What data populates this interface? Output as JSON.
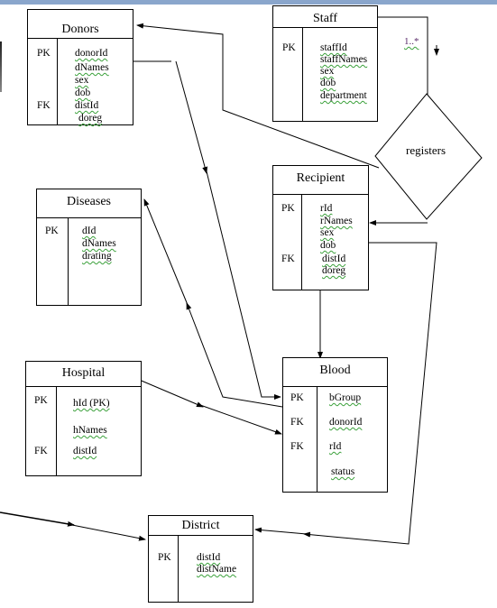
{
  "entities": [
    {
      "name": "Donors",
      "keys": [
        "PK",
        "FK"
      ],
      "attributes": [
        "donorId",
        "dNames",
        "sex",
        "dob",
        "distId",
        "doreg"
      ]
    },
    {
      "name": "Staff",
      "keys": [
        "PK"
      ],
      "attributes": [
        "staffId",
        "staffNames",
        "sex",
        "dob",
        "department"
      ]
    },
    {
      "name": "Diseases",
      "keys": [
        "PK"
      ],
      "attributes": [
        "dId",
        "dNames",
        "drating"
      ]
    },
    {
      "name": "Recipient",
      "keys": [
        "PK",
        "FK"
      ],
      "attributes": [
        "rId",
        "rNames",
        "sex",
        "dob",
        "distId",
        "doreg"
      ]
    },
    {
      "name": "Hospital",
      "keys": [
        "PK",
        "FK"
      ],
      "attributes": [
        "hId (PK)",
        "hNames",
        "distId"
      ]
    },
    {
      "name": "Blood",
      "keys": [
        "PK",
        "FK",
        "FK"
      ],
      "attributes": [
        "bGroup",
        "donorId",
        "rId",
        "status"
      ]
    },
    {
      "name": "District",
      "keys": [
        "PK"
      ],
      "attributes": [
        "distId",
        "distName"
      ]
    }
  ],
  "relationship": {
    "label": "registers",
    "cardinality": "1..*"
  },
  "colors": {
    "line": "#000000",
    "cardinality": "#5a2a6a",
    "spellcheck": "#3aa03a"
  }
}
